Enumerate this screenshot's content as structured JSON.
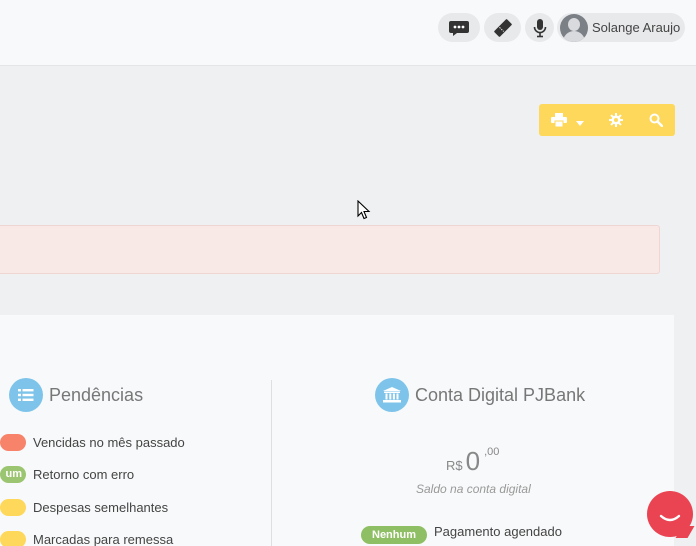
{
  "header": {
    "user_name": "Solange Araujo",
    "icons": [
      "chat-icon",
      "ticket-icon",
      "microphone-icon",
      "user-avatar"
    ]
  },
  "toolbar": {
    "icons": [
      "printer-icon",
      "caret-down-icon",
      "gear-icon",
      "search-icon"
    ]
  },
  "pendencias": {
    "title": "Pendências",
    "icon": "list-icon",
    "items": [
      {
        "badge": "",
        "color": "#f7836a",
        "label": "Vencidas no mês passado"
      },
      {
        "badge": "um",
        "color": "#9cc571",
        "label": "Retorno com erro"
      },
      {
        "badge": "",
        "color": "#fed85b",
        "label": "Despesas semelhantes"
      },
      {
        "badge": "",
        "color": "#fed85b",
        "label": "Marcadas para remessa"
      }
    ]
  },
  "conta": {
    "title": "Conta Digital PJBank",
    "icon": "bank-icon",
    "currency": "R$",
    "balance_int": "0",
    "balance_dec": ",00",
    "caption": "Saldo na conta digital",
    "agendado_badge": "Nenhum",
    "agendado_label": "Pagamento agendado"
  },
  "colors": {
    "accent_yellow": "#fed85b",
    "icon_blue": "#7ec4ea",
    "alert_bg": "#f8e8e6",
    "chat_red": "#ea4352"
  }
}
